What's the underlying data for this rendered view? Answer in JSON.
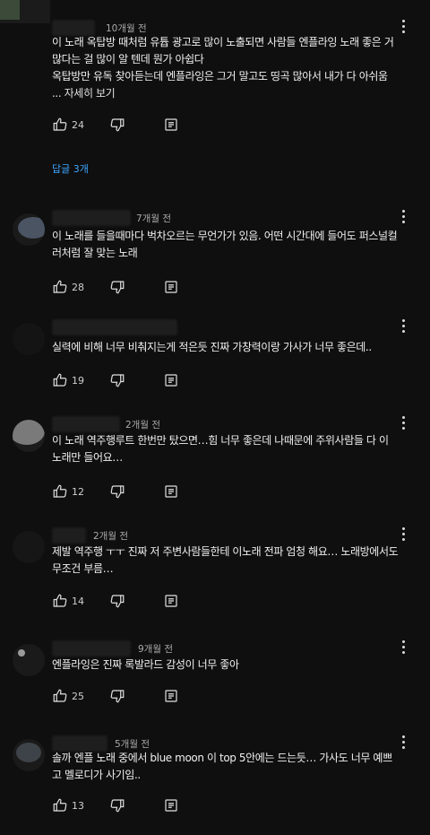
{
  "comments": [
    {
      "time": "10개월 전",
      "body": "이 노래 옥탑방 때처럼 유튭 광고로 많이 노출되면 사람들 엔플라잉 노래 좋은 거 많다는 걸 많이 알 텐데 뭔가 아쉽다",
      "body2": "옥탑방만 유독 찾아듣는데 엔플라잉은 그거 말고도 띵곡 많아서 내가 다 아쉬움",
      "more": "... 자세히 보기",
      "likes": "24",
      "replies": "답글 3개"
    },
    {
      "time": "7개월 전",
      "body": "이 노래를 들을때마다 벅차오르는 무언가가 있음. 어떤 시간대에 들어도 퍼스널컬러처럼 잘 맞는 노래",
      "likes": "28"
    },
    {
      "time": "",
      "body": "실력에 비해 너무 비춰지는게 적은듯 진짜 가창력이랑 가사가 너무 좋은데..",
      "likes": "19"
    },
    {
      "time": "2개월 전",
      "body": "이 노래 역주행루트 한번만 탔으면…힘 너무 좋은데 나때문에 주위사람들 다 이 노래만 들어요…",
      "likes": "12"
    },
    {
      "time": "2개월 전",
      "body": "제발 역주행 ㅜㅜ 진짜 저 주변사람들한테 이노래 전파 엄청 해요… 노래방에서도 무조건 부름…",
      "likes": "14"
    },
    {
      "time": "9개월 전",
      "body": "엔플라잉은 진짜 록발라드 감성이 너무 좋아",
      "likes": "25"
    },
    {
      "time": "5개월 전",
      "body": "솔까 엔플 노래 중에서 blue moon 이 top 5안에는 드는듯… 가사도 너무 예쁘고 멜로디가 사기임..",
      "likes": "13"
    }
  ],
  "icons": {
    "like": "thumbs-up-icon",
    "dislike": "thumbs-down-icon",
    "reply": "reply-icon",
    "menu": "more-vert-icon"
  }
}
